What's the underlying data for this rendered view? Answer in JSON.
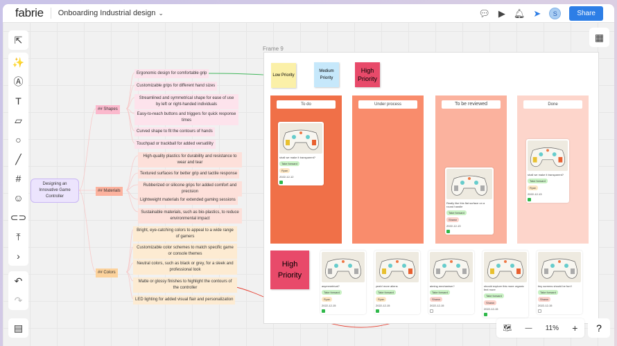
{
  "header": {
    "logo": "fabrie",
    "title": "Onboarding Industrial design",
    "share": "Share",
    "avatar": "S"
  },
  "mindmap": {
    "root": "Designing an Innovative Game Controller",
    "branches": [
      {
        "label": "## Shapes",
        "items": [
          "Ergonomic design for comfortable grip",
          "Customizable grips for different hand sizes",
          "Streamlined and symmetrical shape for ease of use by left or right-handed individuals",
          "Easy-to-reach buttons and triggers for quick response times",
          "Curved shape to fit the contours of hands",
          "Touchpad or trackball for added versatility"
        ]
      },
      {
        "label": "## Materials",
        "items": [
          "High-quality plastics for durability and resistance to wear and tear",
          "Textured surfaces for better grip and tactile response",
          "Rubberized or silicone grips for added comfort and precision",
          "Lightweight materials for extended gaming sessions",
          "Sustainable materials, such as bio-plastics, to reduce environmental impact"
        ]
      },
      {
        "label": "## Colors",
        "items": [
          "Bright, eye-catching colors to appeal to a wide range of gamers",
          "Customizable color schemes to match specific game or console themes",
          "Neutral colors, such as black or grey, for a sleek and professional look",
          "Matte or glossy finishes to highlight the contours of the controller",
          "LED lighting for added visual flair and personalization"
        ]
      }
    ]
  },
  "frame": {
    "label": "Frame 9",
    "stickies": [
      "Low Priority",
      "Medium Priority",
      "High Priority"
    ],
    "columns": [
      "To do",
      "Under process",
      "To be reviewed",
      "Done"
    ],
    "big_sticky": "High Priority",
    "cards": [
      {
        "text": "shall we make it transparent?",
        "tag": "Take forward",
        "owner": "Ryan",
        "date": "2022-12-12",
        "checked": true
      },
      {
        "text": "Really like this flat surface on a round handle",
        "tag": "Take forward",
        "owner": "Shawn",
        "date": "2022-12-13",
        "checked": true
      },
      {
        "text": "shall we make it transparent?",
        "tag": "Take forward",
        "owner": "Ryan",
        "date": "2022-12-13",
        "checked": true
      },
      {
        "text": "asymmetrical?",
        "tag": "Take forward",
        "owner": "Ryan",
        "date": "2022-12-15",
        "checked": true
      },
      {
        "text": "yeah! more aliens",
        "tag": "Take forward",
        "owner": "Ryan",
        "date": "2022-12-15",
        "checked": true
      },
      {
        "text": "aiming mechanism?",
        "tag": "Take forward",
        "owner": "Shawn",
        "date": "2022-12-15",
        "checked": false
      },
      {
        "text": "should explore this more organic feel more",
        "tag": "Take forward",
        "owner": "Shawn",
        "date": "2022-12-15",
        "checked": true
      },
      {
        "text": "tiny screens should be fun!!",
        "tag": "Take forward",
        "owner": "Shawn",
        "date": "2022-12-15",
        "checked": false
      }
    ]
  },
  "zoom": {
    "level": "11%",
    "help": "?"
  },
  "colors": {
    "accent": "#2d7ee6",
    "todo": "#f07048",
    "process": "#f98c6c",
    "review": "#fbb29e",
    "done": "#fdd5cb",
    "high": "#e84a6a",
    "low": "#fbf0a8",
    "medium": "#c6e8fb"
  }
}
